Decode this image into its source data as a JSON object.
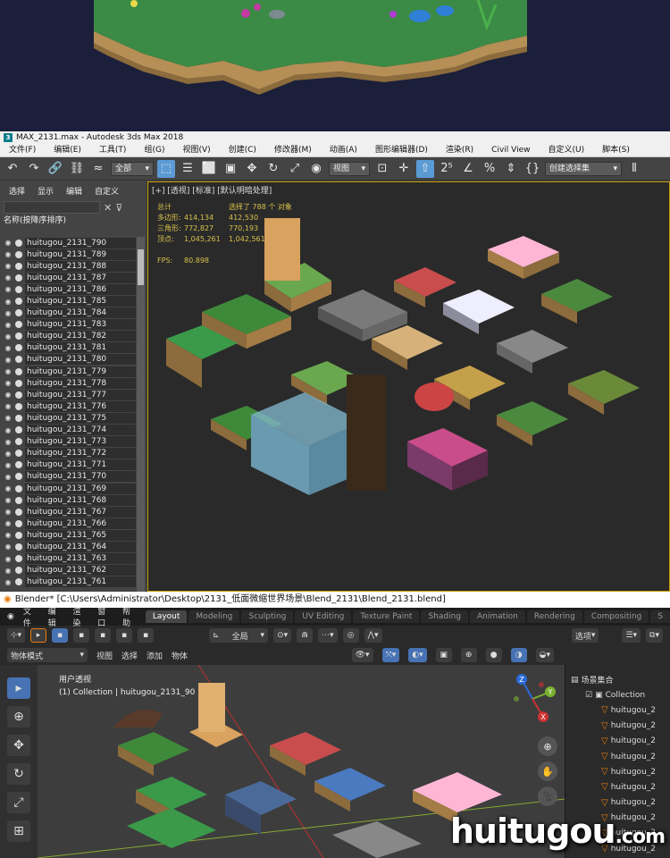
{
  "max": {
    "title": "MAX_2131.max - Autodesk 3ds Max 2018",
    "logo": "3",
    "menu": [
      "文件(F)",
      "编辑(E)",
      "工具(T)",
      "组(G)",
      "视图(V)",
      "创建(C)",
      "修改器(M)",
      "动画(A)",
      "图形编辑器(D)",
      "渲染(R)",
      "Civil View",
      "自定义(U)",
      "脚本(S)"
    ],
    "toolbar": {
      "selection_filter": "全部",
      "ref_coord": "视图",
      "named_selection": "创建选择集",
      "icons": [
        "undo-icon",
        "redo-icon",
        "link-icon",
        "unlink-icon",
        "bind-icon",
        "select-icon",
        "select-by-name-icon",
        "rect-select-icon",
        "window-crossing-icon",
        "move-icon",
        "rotate-icon",
        "scale-icon",
        "place-icon",
        "snap-icon",
        "angle-snap-icon",
        "percent-snap-icon",
        "spinner-snap-icon",
        "mirror-icon"
      ]
    },
    "explorer": {
      "tabs": [
        "选择",
        "显示",
        "编辑",
        "自定义"
      ],
      "column_header": "名称(按降序排序)",
      "items": [
        "huitugou_2131_790",
        "huitugou_2131_789",
        "huitugou_2131_788",
        "huitugou_2131_787",
        "huitugou_2131_786",
        "huitugou_2131_785",
        "huitugou_2131_784",
        "huitugou_2131_783",
        "huitugou_2131_782",
        "huitugou_2131_781",
        "huitugou_2131_780",
        "huitugou_2131_779",
        "huitugou_2131_778",
        "huitugou_2131_777",
        "huitugou_2131_776",
        "huitugou_2131_775",
        "huitugou_2131_774",
        "huitugou_2131_773",
        "huitugou_2131_772",
        "huitugou_2131_771",
        "huitugou_2131_770",
        "huitugou_2131_769",
        "huitugou_2131_768",
        "huitugou_2131_767",
        "huitugou_2131_766",
        "huitugou_2131_765",
        "huitugou_2131_764",
        "huitugou_2131_763",
        "huitugou_2131_762",
        "huitugou_2131_761"
      ]
    },
    "viewport": {
      "label": "[+] [透视] [标准] [默认明暗处理]",
      "stats": {
        "total_label": "总计",
        "selected_label": "选择了 788 个 对象",
        "rows": [
          {
            "k": "多边形:",
            "v1": "414,134",
            "v2": "412,530"
          },
          {
            "k": "三角形:",
            "v1": "772,827",
            "v2": "770,193"
          },
          {
            "k": "顶点:",
            "v1": "1,045,261",
            "v2": "1,042,561"
          }
        ],
        "fps_label": "FPS:",
        "fps": "80.898"
      }
    }
  },
  "blender": {
    "title": "Blender* [C:\\Users\\Administrator\\Desktop\\2131_低面微缩世界场景\\Blend_2131\\Blend_2131.blend]",
    "menu": [
      "文件",
      "编辑",
      "渲染",
      "窗口",
      "帮助"
    ],
    "tabs": [
      "Layout",
      "Modeling",
      "Sculpting",
      "UV Editing",
      "Texture Paint",
      "Shading",
      "Animation",
      "Rendering",
      "Compositing",
      "S"
    ],
    "active_tab": "Layout",
    "tool_header": {
      "orientation": "全局",
      "options": "选项"
    },
    "mode_header": {
      "mode": "物体模式",
      "items": [
        "视图",
        "选择",
        "添加",
        "物体"
      ]
    },
    "viewport": {
      "line1": "用户透视",
      "line2": "(1) Collection | huitugou_2131_90"
    },
    "gizmo": {
      "z": "Z",
      "y": "Y",
      "x": "X"
    },
    "outliner": {
      "scene_collection": "场景集合",
      "collection": "Collection",
      "items": [
        "huitugou_2",
        "huitugou_2",
        "huitugou_2",
        "huitugou_2",
        "huitugou_2",
        "huitugou_2",
        "huitugou_2",
        "huitugou_2",
        "huitugou_2",
        "huitugou_2",
        "huitugou_2"
      ]
    }
  },
  "watermark": {
    "text": "huitugou",
    "suffix": ".com"
  }
}
